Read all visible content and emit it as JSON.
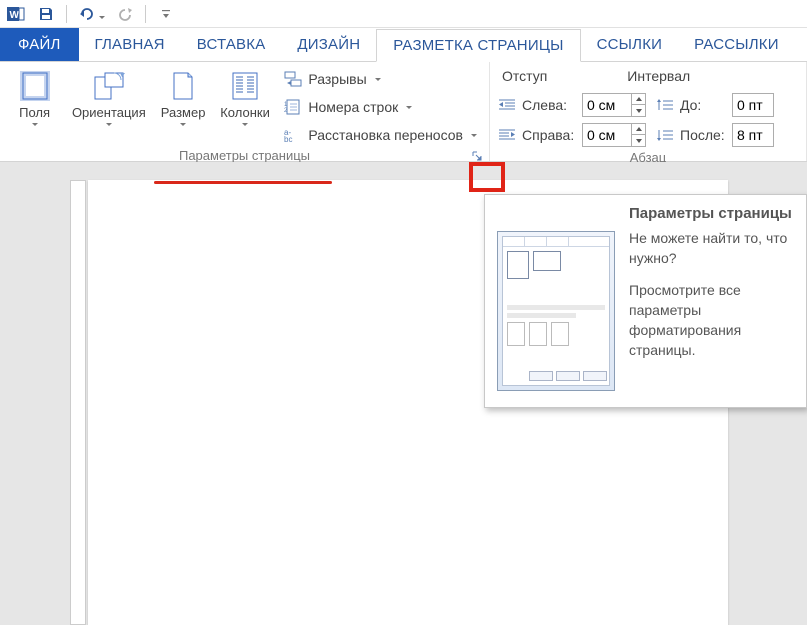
{
  "qat": {
    "app": "word"
  },
  "tabs": {
    "file": "ФАЙЛ",
    "home": "ГЛАВНАЯ",
    "insert": "ВСТАВКА",
    "design": "ДИЗАЙН",
    "layout": "РАЗМЕТКА СТРАНИЦЫ",
    "references": "ССЫЛКИ",
    "mailings": "РАССЫЛКИ"
  },
  "ribbon": {
    "page_setup": {
      "margins": "Поля",
      "orientation": "Ориентация",
      "size": "Размер",
      "columns": "Колонки",
      "breaks": "Разрывы",
      "line_numbers": "Номера строк",
      "hyphenation": "Расстановка переносов",
      "group_label": "Параметры страницы"
    },
    "paragraph": {
      "indent_header": "Отступ",
      "spacing_header": "Интервал",
      "left_label": "Слева:",
      "right_label": "Справа:",
      "before_label": "До:",
      "after_label": "После:",
      "left_value": "0 см",
      "right_value": "0 см",
      "before_value": "0 пт",
      "after_value": "8 пт",
      "group_label": "Абзац"
    }
  },
  "tooltip": {
    "title": "Параметры страницы",
    "line1": "Не можете найти то, что нужно?",
    "line2": "Просмотрите все параметры форматирования страницы."
  }
}
